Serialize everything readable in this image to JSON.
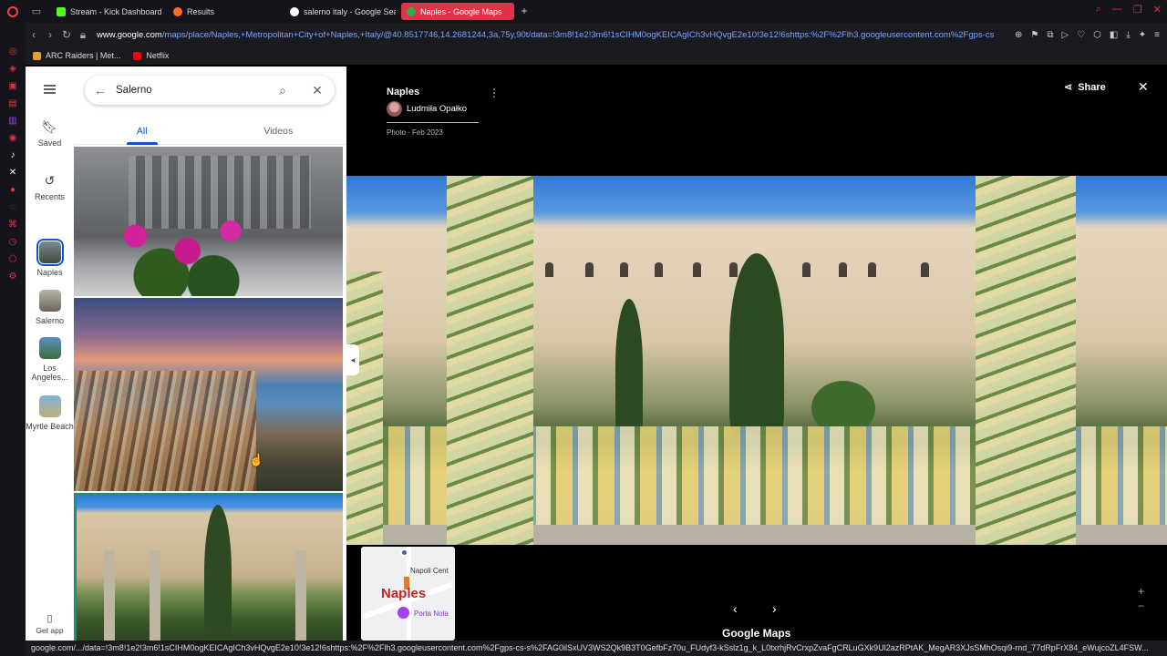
{
  "browser": {
    "tabs": [
      {
        "label": "Stream - Kick Dashboard",
        "color": "#53fc18"
      },
      {
        "label": "Results",
        "color": "#ff6b2c"
      },
      {
        "label": "salerno italy - Google Sea",
        "color": "#4285f4"
      },
      {
        "label": "Naples - Google Maps",
        "color": "#34a853"
      }
    ],
    "new_tab": "+",
    "url_host": "www.google.com",
    "url_rest": "/maps/place/Naples,+Metropolitan+City+of+Naples,+Italy/@40.8517746,14.2681244,3a,75y,90t/data=!3m8!1e2!3m6!1sCIHM0ogKEICAgICh3vHQvgE2e10!3e12!6shttps:%2F%2Flh3.googleusercontent.com%2Fgps-cs",
    "bookmarks": [
      {
        "label": "ARC Raiders | Met...",
        "color": "#e0a030"
      },
      {
        "label": "Netflix",
        "color": "#e50914"
      }
    ],
    "status_url": "google.com/.../data=!3m8!1e2!3m6!1sCIHM0ogKEICAgICh3vHQvgE2e10!3e12!6shttps:%2F%2Flh3.googleusercontent.com%2Fgps-cs-s%2FAG0ilSxUV3WS2Qk9B3T0GefbFz70u_FUdyf3-kSslz1g_k_L0txrhjRvCrxpZvaFgCRLuGXk9Ul2azRPtAK_MegAR3XJsSMhOsqi9-rnd_77dRpFrX84_eWujcoZL4FSW..."
  },
  "maps_rail": {
    "saved": "Saved",
    "recents": "Recents",
    "places": [
      {
        "label": "Naples"
      },
      {
        "label": "Salerno"
      },
      {
        "label": "Los Angeles..."
      },
      {
        "label": "Myrtle Beach"
      }
    ],
    "get_app": "Get app"
  },
  "search": {
    "query": "Salerno",
    "tabs": [
      "All",
      "Videos"
    ],
    "active_tab": "All"
  },
  "viewer": {
    "title": "Naples",
    "author": "Ludmiła Opałko",
    "date": "Photo - Feb 2023",
    "share": "Share",
    "minimap": {
      "label_top": "Napoli Cent",
      "label_city": "Naples",
      "label_poi": "Porta Nola"
    },
    "brand": "Google Maps"
  },
  "colors": {
    "accent": "#e0334a",
    "maps_blue": "#0b57d0",
    "selected_border": "#1e8e7e"
  }
}
